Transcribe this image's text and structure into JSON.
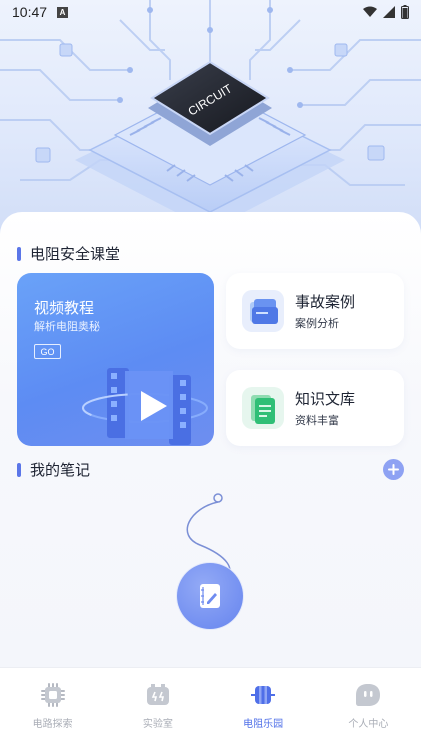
{
  "status_bar": {
    "time": "10:47",
    "badge_letter": "A"
  },
  "hero": {
    "chip_label": "CIRCUIT"
  },
  "classroom": {
    "title": "电阻安全课堂",
    "video": {
      "title": "视频教程",
      "subtitle": "解析电阻奥秘",
      "go_label": "GO"
    },
    "cards": [
      {
        "title": "事故案例",
        "subtitle": "案例分析",
        "icon": "folder-icon"
      },
      {
        "title": "知识文库",
        "subtitle": "资料丰富",
        "icon": "document-icon"
      }
    ]
  },
  "notes": {
    "title": "我的笔记"
  },
  "tabs": [
    {
      "label": "电路探索",
      "icon": "chip-icon",
      "active": false
    },
    {
      "label": "实验室",
      "icon": "battery-icon",
      "active": false
    },
    {
      "label": "电阻乐园",
      "icon": "resistor-icon",
      "active": true
    },
    {
      "label": "个人中心",
      "icon": "profile-icon",
      "active": false
    }
  ],
  "colors": {
    "accent": "#5b76e8",
    "card_blue": "#6aa2f8",
    "tab_active": "#4f6fe8",
    "tab_inactive": "#a9adb6"
  }
}
